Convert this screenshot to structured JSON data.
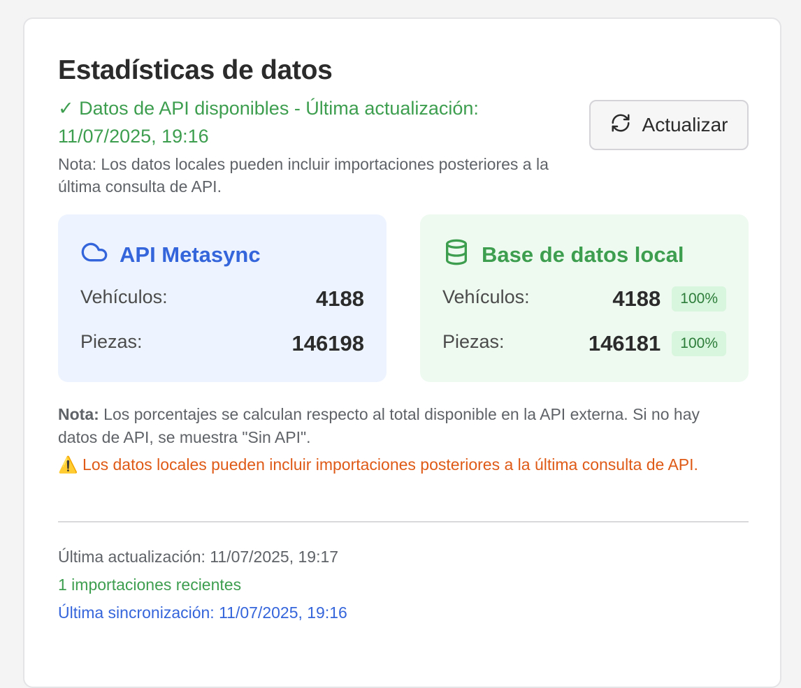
{
  "header": {
    "title": "Estadísticas de datos",
    "api_status": "✓ Datos de API disponibles - Última actualización: 11/07/2025, 19:16",
    "api_note": "Nota: Los datos locales pueden incluir importaciones posteriores a la última consulta de API.",
    "refresh_label": "Actualizar"
  },
  "api_box": {
    "title": "API Metasync",
    "icon": "cloud-icon",
    "rows": [
      {
        "label": "Vehículos:",
        "value": "4188"
      },
      {
        "label": "Piezas:",
        "value": "146198"
      }
    ]
  },
  "local_box": {
    "title": "Base de datos local",
    "icon": "database-icon",
    "rows": [
      {
        "label": "Vehículos:",
        "value": "4188",
        "percent": "100%"
      },
      {
        "label": "Piezas:",
        "value": "146181",
        "percent": "100%"
      }
    ]
  },
  "notes": {
    "percent_note_bold": "Nota:",
    "percent_note_text": " Los porcentajes se calculan respecto al total disponible en la API externa. Si no hay datos de API, se muestra \"Sin API\".",
    "warning_icon": "⚠️",
    "warning_text": " Los datos locales pueden incluir importaciones posteriores a la última consulta de API."
  },
  "footer": {
    "last_update": "Última actualización: 11/07/2025, 19:17",
    "recent_imports": "1 importaciones recientes",
    "last_sync": "Última sincronización: 11/07/2025, 19:16"
  },
  "colors": {
    "api_blue": "#3565db",
    "success_green": "#3e9e4f",
    "warning_orange": "#de5a16",
    "api_box_bg": "#edf4ff",
    "local_box_bg": "#eefaf0"
  }
}
